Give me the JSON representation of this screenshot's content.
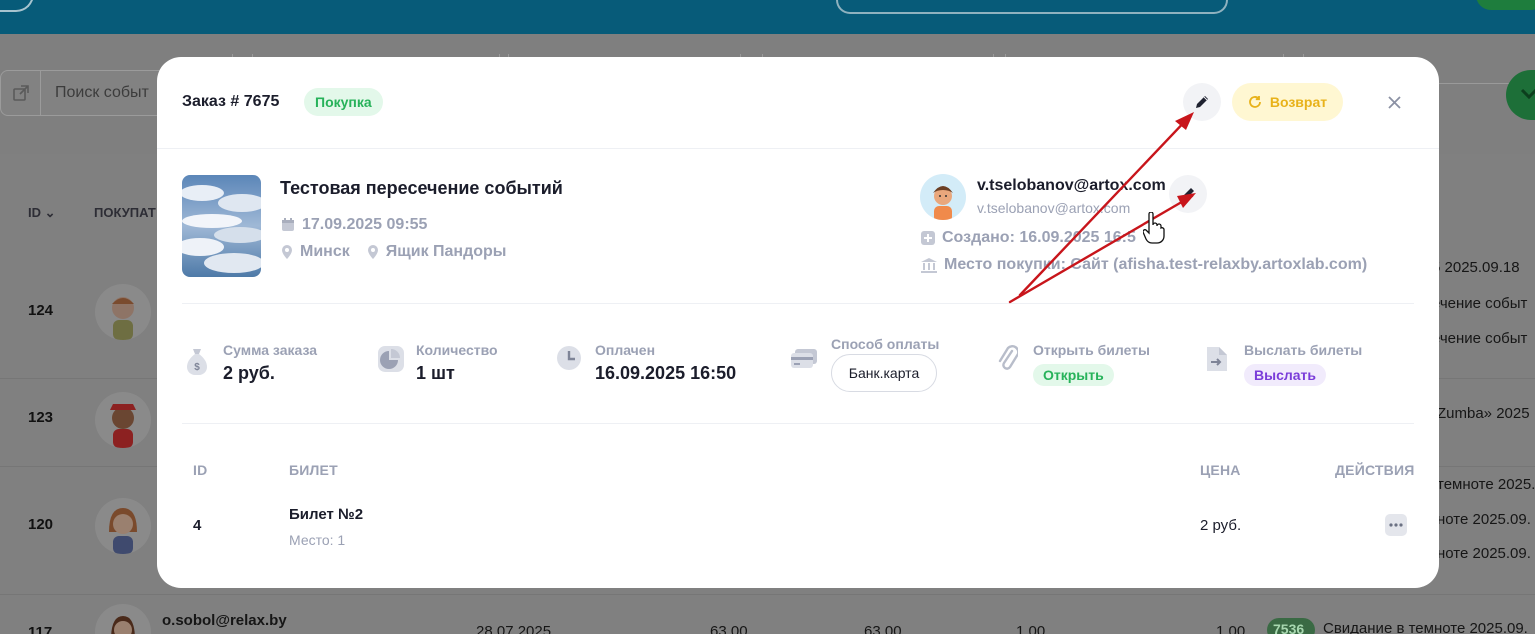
{
  "background": {
    "search_placeholder": "Поиск событ",
    "columns": {
      "id": "ID",
      "buyer": "ПОКУПАТ"
    },
    "rows": [
      {
        "id": "124",
        "right_texts": [
          "5 2025.09.18",
          "ечение событ",
          "ечение событ"
        ]
      },
      {
        "id": "123",
        "right_texts": [
          "Zumba» 2025"
        ]
      },
      {
        "id": "120",
        "right_texts": [
          "темноте 2025.09.",
          "ноте 2025.09.",
          "ноте 2025.09."
        ]
      },
      {
        "id": "117",
        "email": "o.sobol@relax.by",
        "date": "28.07.2025",
        "col1": "63.00",
        "col2": "63.00",
        "col3": "1.00",
        "col4": "1.00",
        "badge": "7536",
        "event": "Свидание в темноте 2025.09."
      }
    ]
  },
  "order": {
    "title": "Заказ # 7675",
    "type_tag": "Покупка",
    "refund_label": "Возврат",
    "event": {
      "title": "Тестовая пересечение событий",
      "datetime": "17.09.2025 09:55",
      "city": "Минск",
      "venue": "Ящик Пандоры"
    },
    "customer": {
      "name": "v.tselobanov@artox.com",
      "email": "v.tselobanov@artox.com",
      "created": "Создано: 16.09.2025 16:5",
      "purchase_place": "Место покупки: Сайт (afisha.test-relaxby.artoxlab.com)"
    },
    "stats": {
      "amount_label": "Сумма заказа",
      "amount_value": "2 руб.",
      "qty_label": "Количество",
      "qty_value": "1 шт",
      "paid_label": "Оплачен",
      "paid_value": "16.09.2025 16:50",
      "payment_label": "Способ оплаты",
      "payment_value": "Банк.карта",
      "open_label": "Открыть билеты",
      "open_action": "Открыть",
      "send_label": "Выслать билеты",
      "send_action": "Выслать"
    },
    "table": {
      "headers": {
        "id": "ID",
        "ticket": "БИЛЕТ",
        "price": "ЦЕНА",
        "actions": "ДЕЙСТВИЯ"
      },
      "rows": [
        {
          "id": "4",
          "ticket": "Билет №2",
          "seat": "Место: 1",
          "price": "2 руб."
        }
      ]
    }
  },
  "colors": {
    "green_tag": "#27b25a",
    "refund": "#e8b21a",
    "send_tag": "#7a3cd9",
    "annotation_arrow": "#c8151b"
  },
  "icons": [
    "pencil-icon",
    "refresh-icon",
    "close-icon",
    "calendar-icon",
    "location-pin-icon",
    "plus-square-icon",
    "bank-icon",
    "money-bag-icon",
    "pie-chart-icon",
    "clock-icon",
    "card-icon",
    "paperclip-icon",
    "send-file-icon",
    "more-icon",
    "hand-cursor-icon",
    "external-link-icon",
    "chevron-down-icon"
  ]
}
